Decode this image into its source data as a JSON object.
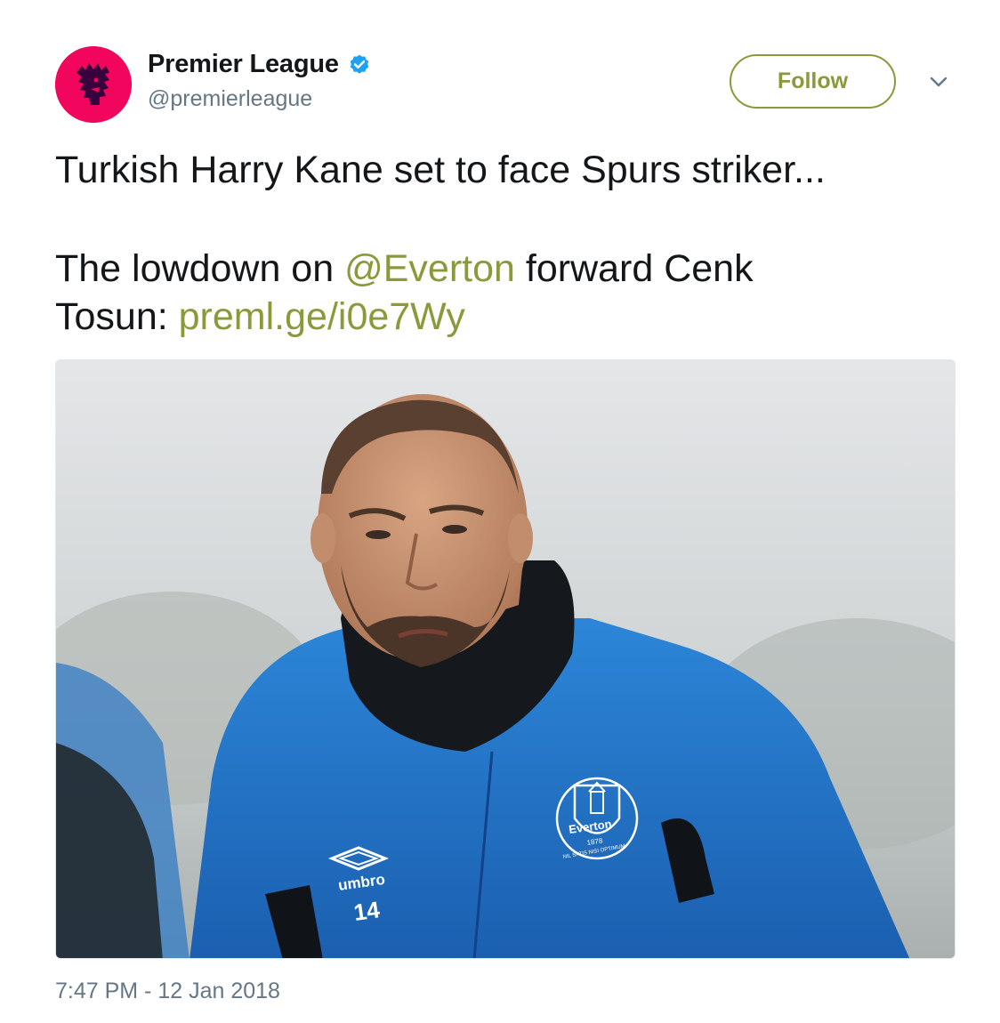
{
  "account": {
    "display_name": "Premier League",
    "handle": "@premierleague",
    "verified": true,
    "avatar_color": "#f2055c"
  },
  "follow_button": {
    "label": "Follow",
    "color": "#8a9a3a"
  },
  "tweet": {
    "line1": "Turkish Harry Kane set to face Spurs striker...",
    "line2_prefix": "The lowdown on ",
    "mention": "@Everton",
    "line2_suffix": " forward Cenk",
    "line3_prefix": "Tosun: ",
    "url": "preml.ge/i0e7Wy",
    "link_color": "#8a9a3a"
  },
  "media": {
    "badge_brand": "umbro",
    "shirt_number": "14",
    "crest_text": "Everton",
    "crest_year": "1878",
    "crest_motto": "NIL SATIS NISI OPTIMUM"
  },
  "timestamp": "7:47 PM - 12 Jan 2018",
  "icons": {
    "verified": "verified-badge-icon",
    "caret": "chevron-down-icon",
    "avatar": "premier-league-lion-logo"
  }
}
